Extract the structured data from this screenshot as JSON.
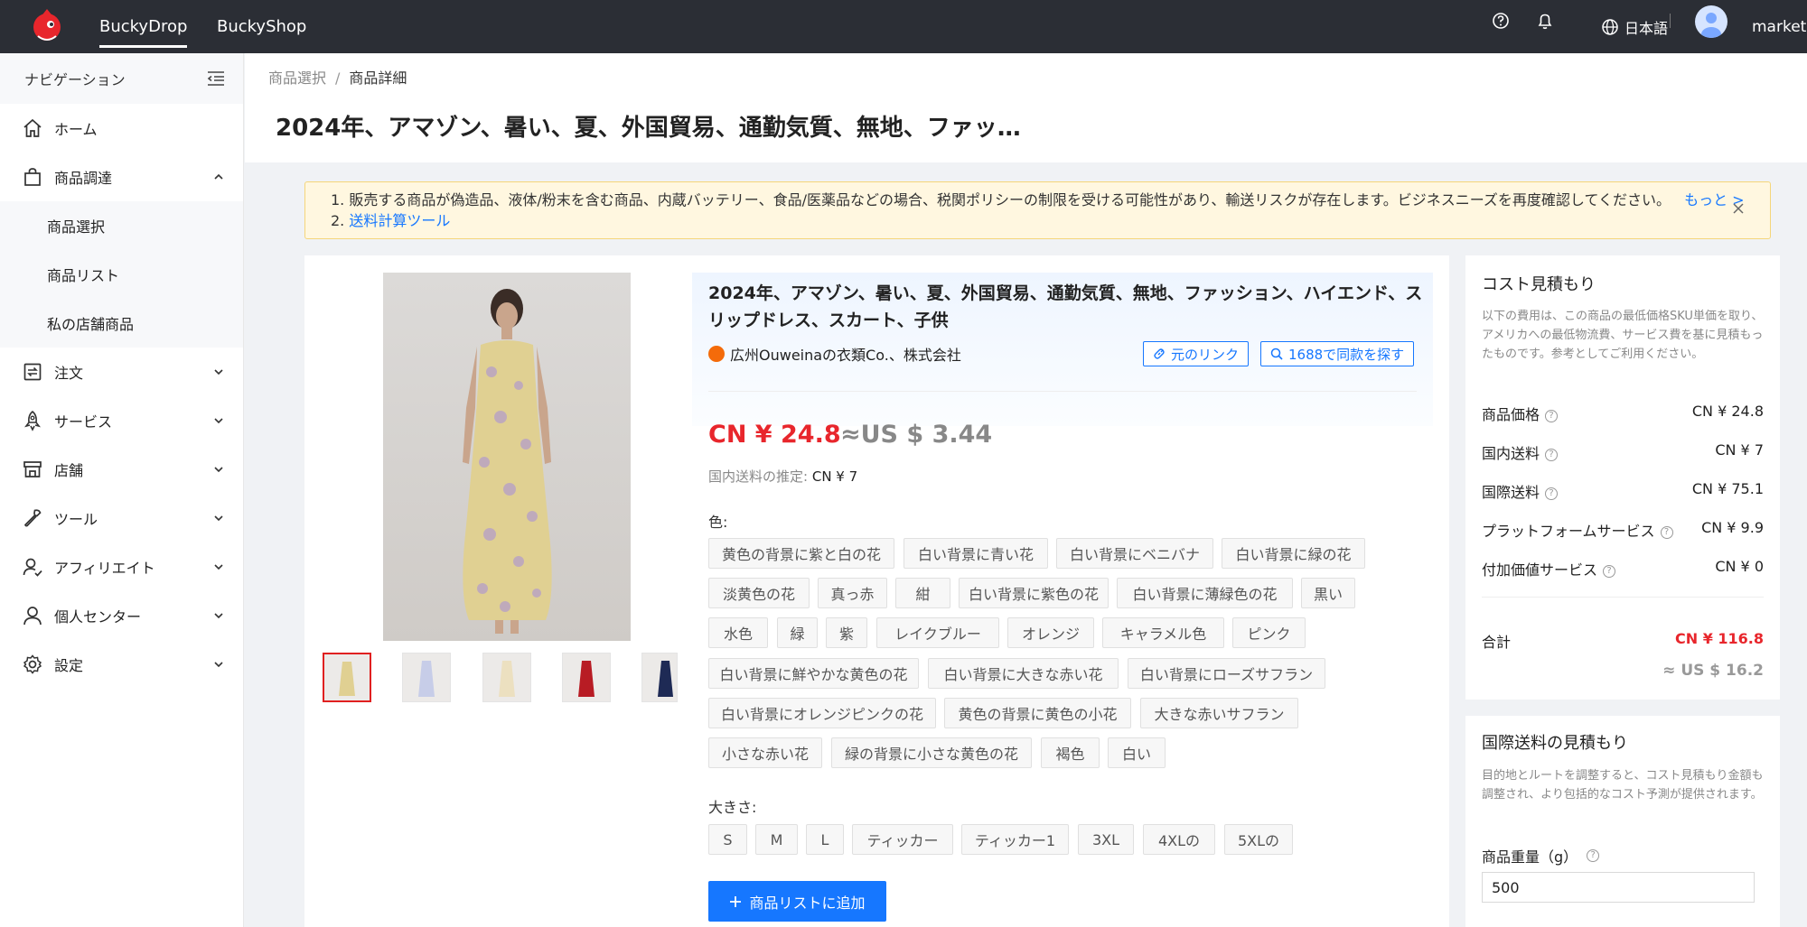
{
  "topbar": {
    "tabs": [
      "BuckyDrop",
      "BuckyShop"
    ],
    "language": "日本語",
    "username": "marketing"
  },
  "sidebar": {
    "header": "ナビゲーション",
    "items": [
      {
        "label": "ホーム",
        "icon": "home-icon"
      },
      {
        "label": "商品調達",
        "icon": "shopping-bag-icon",
        "expanded": true
      },
      {
        "label": "注文",
        "icon": "order-icon"
      },
      {
        "label": "サービス",
        "icon": "rocket-icon"
      },
      {
        "label": "店舗",
        "icon": "store-icon"
      },
      {
        "label": "ツール",
        "icon": "wrench-icon"
      },
      {
        "label": "アフィリエイト",
        "icon": "affiliate-icon"
      },
      {
        "label": "個人センター",
        "icon": "user-icon"
      },
      {
        "label": "設定",
        "icon": "gear-icon"
      }
    ],
    "sub_items": [
      "商品選択",
      "商品リスト",
      "私の店舗商品"
    ]
  },
  "breadcrumb": {
    "parent": "商品選択",
    "separator": "/",
    "current": "商品詳細"
  },
  "page_title": "2024年、アマゾン、暑い、夏、外国貿易、通勤気質、無地、ファッ…",
  "notice": {
    "line1": "1. 販売する商品が偽造品、液体/粉末を含む商品、内蔵バッテリー、食品/医薬品などの場合、税関ポリシーの制限を受ける可能性があり、輸送リスクが存在します。ビジネスニーズを再度確認してください。",
    "more": "もっと >",
    "line2_prefix": "2.",
    "line2_link": "送料計算ツール"
  },
  "product": {
    "title": "2024年、アマゾン、暑い、夏、外国貿易、通勤気質、無地、ファッション、ハイエンド、スリップドレス、スカート、子供",
    "supplier": "広州Ouweinaの衣類Co.、株式会社",
    "original_link": "元のリンク",
    "find_same": "1688で同款を探す",
    "price_cn": "CN ¥ 24.8",
    "price_us": "≈US $ 3.44",
    "domestic_ship_label": "国内送料の推定:",
    "domestic_ship_value": "CN ¥ 7",
    "color_label": "色:",
    "colors": [
      "黄色の背景に紫と白の花",
      "白い背景に青い花",
      "白い背景にベニバナ",
      "白い背景に緑の花",
      "淡黄色の花",
      "真っ赤",
      "紺",
      "白い背景に紫色の花",
      "白い背景に薄緑色の花",
      "黒い",
      "水色",
      "緑",
      "紫",
      "レイクブルー",
      "オレンジ",
      "キャラメル色",
      "ピンク",
      "白い背景に鮮やかな黄色の花",
      "白い背景に大きな赤い花",
      "白い背景にローズサフラン",
      "白い背景にオレンジピンクの花",
      "黄色の背景に黄色の小花",
      "大きな赤いサフラン",
      "小さな赤い花",
      "緑の背景に小さな黄色の花",
      "褐色",
      "白い"
    ],
    "size_label": "大きさ:",
    "sizes": [
      "S",
      "M",
      "L",
      "ティッカー",
      "ティッカー1",
      "3XL",
      "4XLの",
      "5XLの"
    ],
    "add_button": "商品リストに追加"
  },
  "cost_estimate": {
    "title": "コスト見積もり",
    "desc": "以下の費用は、この商品の最低価格SKU単価を取り、アメリカへの最低物流費、サービス費を基に見積もったものです。参考としてご利用ください。",
    "rows": [
      {
        "label": "商品価格",
        "value": "CN ¥ 24.8"
      },
      {
        "label": "国内送料",
        "value": "CN ¥ 7"
      },
      {
        "label": "国際送料",
        "value": "CN ¥ 75.1"
      },
      {
        "label": "プラットフォームサービス",
        "value": "CN ¥ 9.9"
      },
      {
        "label": "付加価値サービス",
        "value": "CN ¥ 0"
      }
    ],
    "total_label": "合計",
    "total_value": "CN ¥ 116.8",
    "total_us": "≈ US $ 16.2"
  },
  "intl_shipping": {
    "title": "国際送料の見積もり",
    "desc": "目的地とルートを調整すると、コスト見積もり金額も調整され、より包括的なコスト予測が提供されます。",
    "weight_label": "商品重量（g）",
    "weight_value": "500"
  },
  "colors": {
    "accent": "#1677ff",
    "price": "#e8262c",
    "topbar": "#2b2e35"
  }
}
